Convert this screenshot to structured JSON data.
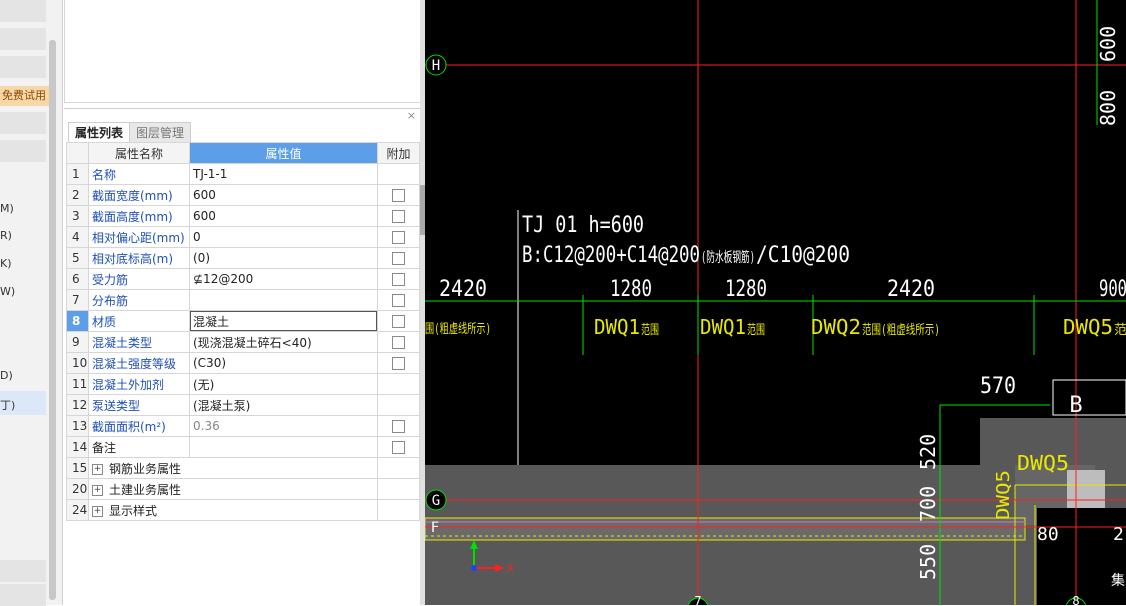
{
  "sidebar": {
    "free_trial_label": "免费试用",
    "items": [
      "M)",
      "R)",
      "K)",
      "W)",
      "D)",
      "丁)"
    ]
  },
  "property_panel": {
    "close_symbol": "×",
    "tabs": [
      {
        "label": "属性列表",
        "active": true
      },
      {
        "label": "图层管理",
        "active": false
      }
    ],
    "columns": {
      "name": "属性名称",
      "value": "属性值",
      "extra": "附加"
    },
    "rows": [
      {
        "num": "1",
        "name": "名称",
        "value": "TJ-1-1",
        "checkbox": false
      },
      {
        "num": "2",
        "name": "截面宽度(mm)",
        "value": "600",
        "checkbox": true
      },
      {
        "num": "3",
        "name": "截面高度(mm)",
        "value": "600",
        "checkbox": true
      },
      {
        "num": "4",
        "name": "相对偏心距(mm)",
        "value": "0",
        "checkbox": true
      },
      {
        "num": "5",
        "name": "相对底标高(m)",
        "value": "(0)",
        "checkbox": true
      },
      {
        "num": "6",
        "name": "受力筋",
        "value": "⊈12@200",
        "checkbox": true
      },
      {
        "num": "7",
        "name": "分布筋",
        "value": "",
        "checkbox": true
      },
      {
        "num": "8",
        "name": "材质",
        "value": "混凝土",
        "checkbox": true,
        "selected": true
      },
      {
        "num": "9",
        "name": "混凝土类型",
        "value": "(现浇混凝土碎石<40)",
        "checkbox": true
      },
      {
        "num": "10",
        "name": "混凝土强度等级",
        "value": "(C30)",
        "checkbox": true
      },
      {
        "num": "11",
        "name": "混凝土外加剂",
        "value": "(无)",
        "checkbox": false
      },
      {
        "num": "12",
        "name": "泵送类型",
        "value": "(混凝土泵)",
        "checkbox": false
      },
      {
        "num": "13",
        "name": "截面面积(m²)",
        "value": "0.36",
        "checkbox": true,
        "grey": true
      },
      {
        "num": "14",
        "name": "备注",
        "value": "",
        "checkbox": true,
        "black": true
      }
    ],
    "groups": [
      {
        "num": "15",
        "label": "钢筋业务属性"
      },
      {
        "num": "20",
        "label": "土建业务属性"
      },
      {
        "num": "24",
        "label": "显示样式"
      }
    ]
  },
  "cad": {
    "colors": {
      "axis_red": "#ff2020",
      "dim_green": "#00e000",
      "label_yellow": "#e8e800",
      "text_white": "#ffffff",
      "wall_grey": "#555555"
    },
    "axis_labels": {
      "h": "H",
      "g": "G",
      "f": "F",
      "seven": "7",
      "b": "B",
      "eight": "8"
    },
    "footing_title": "TJ 01 h=600",
    "footing_rebar": "B:C12@200+C14@200",
    "footing_rebar_note": "(防水板钢筋)",
    "footing_rebar_tail": "/C10@200",
    "dims_top": [
      "2420",
      "1280",
      "1280",
      "2420",
      "900"
    ],
    "wall_labels": [
      "DWQ1",
      "DWQ1",
      "DWQ2",
      "DWQ5"
    ],
    "wall_note_short": "范围",
    "wall_note_long": "范围(粗虚线所示)",
    "wall_note_left": "围(粗虚线所示)",
    "right_dims": [
      "600",
      "800"
    ],
    "dim_570": "570",
    "vertical_dims": [
      "520",
      "700",
      "550"
    ],
    "dwq5_a": "DWQ5",
    "dwq5_b": "DWQ5",
    "dim_80": "80",
    "dim_2": "2",
    "ucs_x": "X",
    "cut_text": "集"
  }
}
